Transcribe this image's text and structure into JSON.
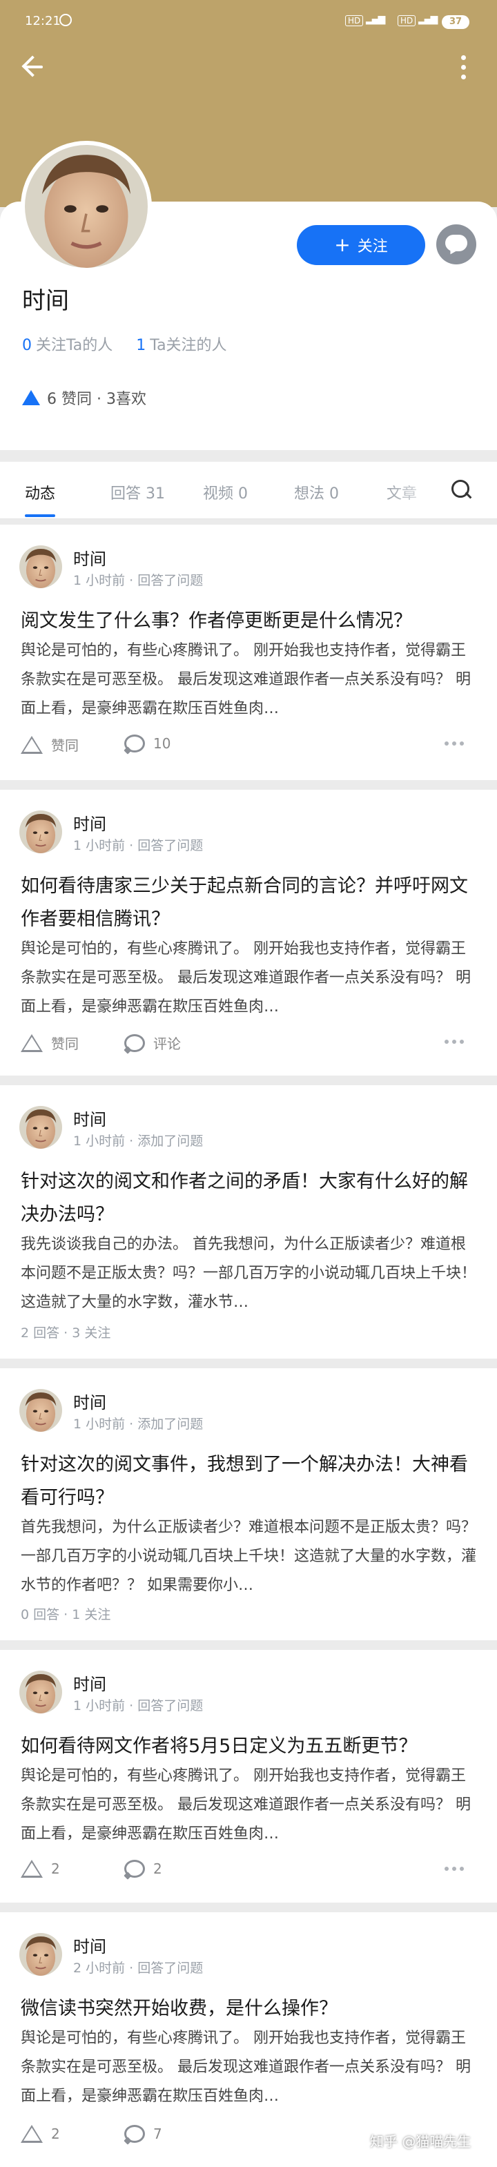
{
  "status_bar": {
    "time": "12:21",
    "sig1": "HD",
    "sig2": "HD",
    "battery": "37"
  },
  "profile": {
    "name": "时间",
    "following_count": "0",
    "following_label": "关注Ta的人",
    "followers_count": "1",
    "followers_label": "Ta关注的人",
    "likes_text": "6 赞同 · 3喜欢",
    "follow_button": "关注"
  },
  "colors": {
    "header": "#bda36a",
    "accent": "#1772f6"
  },
  "tabs": [
    {
      "label": "动态"
    },
    {
      "label": "回答 31"
    },
    {
      "label": "视频 0"
    },
    {
      "label": "想法 0"
    },
    {
      "label": "文章"
    }
  ],
  "cards": [
    {
      "author": "时间",
      "meta": "1 小时前 · 回答了问题",
      "title": "阅文发生了什么事？作者停更断更是什么情况？",
      "excerpt": "舆论是可怕的，有些心疼腾讯了。 刚开始我也支持作者，觉得霸王条款实在是可恶至极。 最后发现这难道跟作者一点关系没有吗？ 明面上看，是豪绅恶霸在欺压百姓鱼肉…",
      "vote_label": "赞同",
      "comment_label": "10"
    },
    {
      "author": "时间",
      "meta": "1 小时前 · 回答了问题",
      "title": "如何看待唐家三少关于起点新合同的言论？并呼吁网文作者要相信腾讯？",
      "excerpt": "舆论是可怕的，有些心疼腾讯了。 刚开始我也支持作者，觉得霸王条款实在是可恶至极。 最后发现这难道跟作者一点关系没有吗？ 明面上看，是豪绅恶霸在欺压百姓鱼肉…",
      "vote_label": "赞同",
      "comment_label": "评论"
    },
    {
      "author": "时间",
      "meta": "1 小时前 · 添加了问题",
      "title": "针对这次的阅文和作者之间的矛盾！大家有什么好的解决办法吗？",
      "excerpt": "我先谈谈我自己的办法。 首先我想问，为什么正版读者少？难道根本问题不是正版太贵？吗？一部几百万字的小说动辄几百块上千块！这造就了大量的水字数，灌水节…",
      "stats": "2 回答 · 3 关注"
    },
    {
      "author": "时间",
      "meta": "1 小时前 · 添加了问题",
      "title": "针对这次的阅文事件，我想到了一个解决办法！大神看看可行吗？",
      "excerpt": "首先我想问，为什么正版读者少？难道根本问题不是正版太贵？吗？一部几百万字的小说动辄几百块上千块！这造就了大量的水字数，灌水节的作者吧？？ 如果需要你小…",
      "stats": "0 回答 · 1 关注"
    },
    {
      "author": "时间",
      "meta": "1 小时前 · 回答了问题",
      "title": "如何看待网文作者将5月5日定义为五五断更节？",
      "excerpt": "舆论是可怕的，有些心疼腾讯了。 刚开始我也支持作者，觉得霸王条款实在是可恶至极。 最后发现这难道跟作者一点关系没有吗？ 明面上看，是豪绅恶霸在欺压百姓鱼肉…",
      "vote_label": "2",
      "comment_label": "2"
    },
    {
      "author": "时间",
      "meta": "2 小时前 · 回答了问题",
      "title": "微信读书突然开始收费，是什么操作？",
      "excerpt": "舆论是可怕的，有些心疼腾讯了。 刚开始我也支持作者，觉得霸王条款实在是可恶至极。 最后发现这难道跟作者一点关系没有吗？ 明面上看，是豪绅恶霸在欺压百姓鱼肉…",
      "vote_label": "2",
      "comment_label": "7"
    }
  ],
  "watermark": "知乎 @猫喵先生"
}
